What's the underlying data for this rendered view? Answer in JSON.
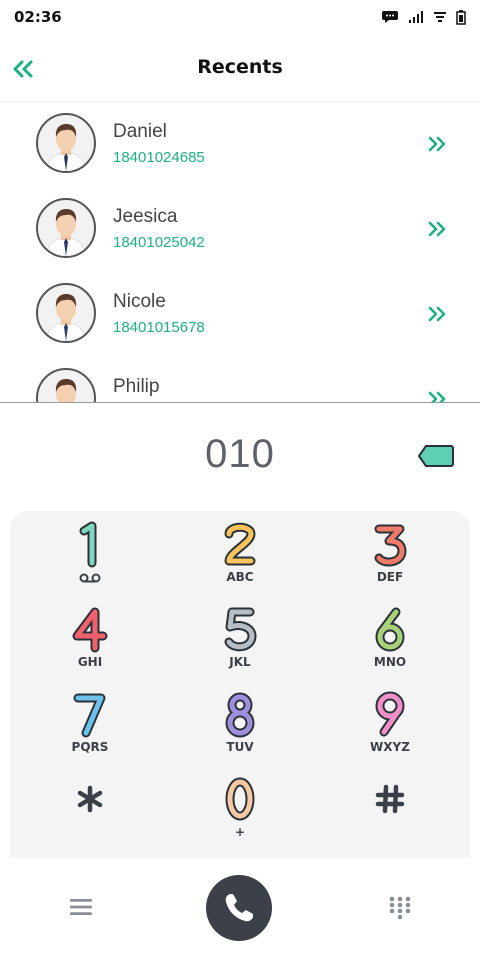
{
  "status_bar": {
    "time": "02:36"
  },
  "header": {
    "title": "Recents"
  },
  "recents": [
    {
      "name": "Daniel",
      "number": "18401024685"
    },
    {
      "name": "Jeesica",
      "number": "18401025042"
    },
    {
      "name": "Nicole",
      "number": "18401015678"
    },
    {
      "name": "Philip",
      "number": ""
    }
  ],
  "dialer": {
    "input_value": "010"
  },
  "keypad": [
    {
      "digit": "1",
      "sub": "",
      "color": "#7dd6c2",
      "sub_icon": "voicemail-icon"
    },
    {
      "digit": "2",
      "sub": "ABC",
      "color": "#f7c35a"
    },
    {
      "digit": "3",
      "sub": "DEF",
      "color": "#f07a6a"
    },
    {
      "digit": "4",
      "sub": "GHI",
      "color": "#f2606e"
    },
    {
      "digit": "5",
      "sub": "JKL",
      "color": "#b8bec6"
    },
    {
      "digit": "6",
      "sub": "MNO",
      "color": "#a8d27a"
    },
    {
      "digit": "7",
      "sub": "PQRS",
      "color": "#6cc2ec"
    },
    {
      "digit": "8",
      "sub": "TUV",
      "color": "#9f8fdc"
    },
    {
      "digit": "9",
      "sub": "WXYZ",
      "color": "#f08fc8"
    },
    {
      "digit": "*",
      "sub": "",
      "color": "#3b3f47"
    },
    {
      "digit": "0",
      "sub": "+",
      "color": "#f7c9a3"
    },
    {
      "digit": "#",
      "sub": "",
      "color": "#3b3f47"
    }
  ],
  "colors": {
    "accent": "#1fae86",
    "call_button": "#3b4049",
    "keypad_bg": "#f4f4f4"
  }
}
